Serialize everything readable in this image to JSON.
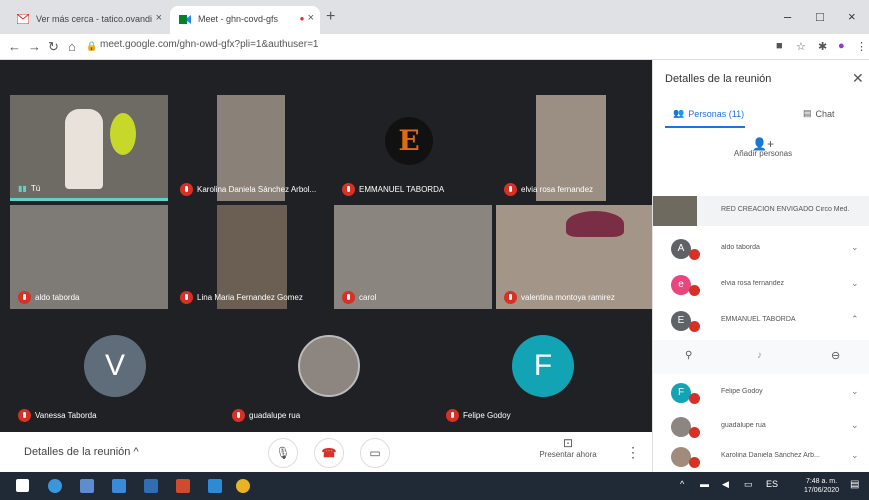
{
  "browser": {
    "tabs": [
      {
        "title": "Ver más cerca - tatico.ovandi"
      },
      {
        "title": "Meet - ghn-covd-gfs"
      }
    ],
    "url": "meet.google.com/ghn-owd-gfx?pli=1&authuser=1"
  },
  "tiles": [
    {
      "name": "Tú",
      "kind": "video",
      "bg": "#6e6a64"
    },
    {
      "name": "Karolina Daniela Sánchez Arbol...",
      "kind": "video",
      "bg": "#8a8278"
    },
    {
      "name": "EMMANUEL TABORDA",
      "kind": "avatar",
      "bg": "#202124",
      "letter": "E",
      "color": "#e06a12"
    },
    {
      "name": "elvia rosa fernandez",
      "kind": "video",
      "bg": "#9a8f82"
    },
    {
      "name": "aldo taborda",
      "kind": "video",
      "bg": "#7e7a76"
    },
    {
      "name": "Lina Maria Fernandez Gomez",
      "kind": "video",
      "bg": "#6b5e52"
    },
    {
      "name": "carol",
      "kind": "video",
      "bg": "#8b8580"
    },
    {
      "name": "valentina montoya ramirez",
      "kind": "video",
      "bg": "#a39588"
    },
    {
      "name": "Vanessa Taborda",
      "kind": "avatar",
      "bg": "#202124",
      "letter": "V",
      "color": "#5f6d7a"
    },
    {
      "name": "guadalupe rua",
      "kind": "photo",
      "bg": "#202124"
    },
    {
      "name": "Felipe Godoy",
      "kind": "avatar",
      "bg": "#202124",
      "letter": "F",
      "color": "#12a4b4"
    }
  ],
  "controls": {
    "details_label": "Detalles de la reunión",
    "present_label": "Presentar ahora"
  },
  "panel": {
    "title": "Detalles de la reunión",
    "people_tab": "Personas (11)",
    "chat_tab": "Chat",
    "add_label": "Añadir personas",
    "participants": [
      {
        "name": "RED CREACIÓN ENVIGADO Circo Med...",
        "avatar": "photo",
        "color": "#6f6a60"
      },
      {
        "name": "aldo taborda",
        "avatar": "A",
        "color": "#5f6368"
      },
      {
        "name": "elvia rosa fernandez",
        "avatar": "e",
        "color": "#e8467c"
      },
      {
        "name": "EMMANUEL TABORDA",
        "avatar": "E",
        "color": "#5f6368"
      },
      {
        "name": "Felipe Godoy",
        "avatar": "F",
        "color": "#12a4b4"
      },
      {
        "name": "guadalupe rua",
        "avatar": "photo",
        "color": "#8c8580"
      },
      {
        "name": "Karolina Daniela Sánchez Arb...",
        "avatar": "photo",
        "color": "#a08c7c"
      }
    ]
  },
  "taskbar": {
    "time": "7:48 a. m.",
    "date": "17/06/2020"
  }
}
